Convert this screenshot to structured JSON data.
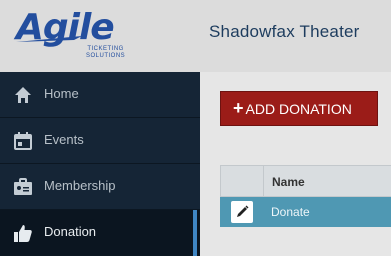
{
  "header": {
    "logo_text": "Agile",
    "logo_tagline_1": "TICKETING",
    "logo_tagline_2": "SOLUTIONS",
    "theater_name": "Shadowfax Theater"
  },
  "sidebar": {
    "items": [
      {
        "label": "Home",
        "icon": "home-icon"
      },
      {
        "label": "Events",
        "icon": "calendar-icon"
      },
      {
        "label": "Membership",
        "icon": "membership-card-icon"
      },
      {
        "label": "Donation",
        "icon": "thumbs-up-icon",
        "active": true
      }
    ]
  },
  "main": {
    "add_button_plus": "+",
    "add_button_label": "ADD DONATION",
    "table": {
      "columns": [
        "",
        "Name"
      ],
      "rows": [
        {
          "name": "Donate"
        }
      ]
    }
  },
  "colors": {
    "sidebar_bg": "#152536",
    "add_button_bg": "#9b1c18",
    "row_highlight": "#4f98b3",
    "theater_text": "#1d3c5e",
    "logo_blue": "#234e9e"
  }
}
